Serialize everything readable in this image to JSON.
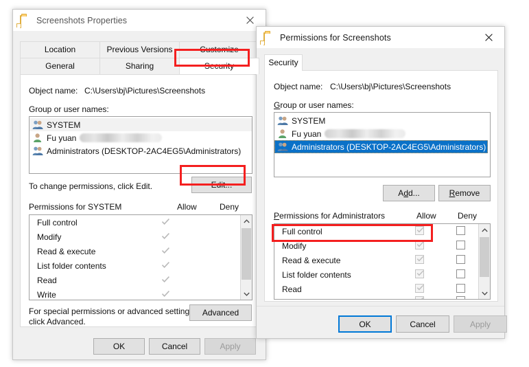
{
  "properties_dialog": {
    "title": "Screenshots Properties",
    "icon": "folder-icon",
    "close_label": "✕",
    "tabs_row1": [
      {
        "label": "Location"
      },
      {
        "label": "Previous Versions"
      },
      {
        "label": "Customize"
      }
    ],
    "tabs_row2": [
      {
        "label": "General"
      },
      {
        "label": "Sharing"
      },
      {
        "label": "Security"
      }
    ],
    "active_tab": "Security",
    "object_name_label": "Object name:",
    "object_name_value": "C:\\Users\\bj\\Pictures\\Screenshots",
    "group_label": "Group or user names:",
    "users": [
      {
        "name": "SYSTEM",
        "icon": "group-icon",
        "redacted": false,
        "highlight": true
      },
      {
        "name": "Fu yuan",
        "icon": "user-icon",
        "redacted": true,
        "highlight": false
      },
      {
        "name": "Administrators (DESKTOP-2AC4EG5\\Administrators)",
        "icon": "group-icon",
        "redacted": false,
        "highlight": false
      }
    ],
    "edit_hint": "To change permissions, click Edit.",
    "edit_button": "Edit...",
    "permissions_header": "Permissions for SYSTEM",
    "allow_column": "Allow",
    "deny_column": "Deny",
    "permissions": [
      {
        "name": "Full control",
        "allow": "check-dim",
        "deny": "none"
      },
      {
        "name": "Modify",
        "allow": "check-dim",
        "deny": "none"
      },
      {
        "name": "Read & execute",
        "allow": "check-dim",
        "deny": "none"
      },
      {
        "name": "List folder contents",
        "allow": "check-dim",
        "deny": "none"
      },
      {
        "name": "Read",
        "allow": "check-dim",
        "deny": "none"
      },
      {
        "name": "Write",
        "allow": "check-dim",
        "deny": "none"
      }
    ],
    "advanced_hint_line1": "For special permissions or advanced settings,",
    "advanced_hint_line2": "click Advanced.",
    "advanced_button": "Advanced",
    "ok_button": "OK",
    "cancel_button": "Cancel",
    "apply_button": "Apply"
  },
  "permissions_dialog": {
    "title": "Permissions for Screenshots",
    "icon": "folder-icon",
    "close_label": "✕",
    "tab_label": "Security",
    "object_name_label": "Object name:",
    "object_name_value": "C:\\Users\\bj\\Pictures\\Screenshots",
    "group_label": "Group or user names:",
    "users": [
      {
        "name": "SYSTEM",
        "icon": "group-icon",
        "redacted": false,
        "selected": false
      },
      {
        "name": "Fu yuan",
        "icon": "user-icon",
        "redacted": true,
        "selected": false
      },
      {
        "name": "Administrators (DESKTOP-2AC4EG5\\Administrators)",
        "icon": "group-icon",
        "redacted": false,
        "selected": true
      }
    ],
    "add_button": "Add...",
    "add_button_accel": "d",
    "remove_button": "Remove",
    "permissions_header": "Permissions for Administrators",
    "allow_column": "Allow",
    "deny_column": "Deny",
    "permissions": [
      {
        "name": "Full control",
        "allow": "checkbox-checked-dim",
        "deny": "checkbox-empty"
      },
      {
        "name": "Modify",
        "allow": "checkbox-checked-dim",
        "deny": "checkbox-empty"
      },
      {
        "name": "Read & execute",
        "allow": "checkbox-checked-dim",
        "deny": "checkbox-empty"
      },
      {
        "name": "List folder contents",
        "allow": "checkbox-checked-dim",
        "deny": "checkbox-empty"
      },
      {
        "name": "Read",
        "allow": "checkbox-checked-dim",
        "deny": "checkbox-empty"
      }
    ],
    "ok_button": "OK",
    "cancel_button": "Cancel",
    "apply_button": "Apply"
  },
  "annotations": {
    "highlight_color": "#f41f1f",
    "boxes": [
      {
        "target": "security-tab"
      },
      {
        "target": "edit-button"
      },
      {
        "target": "full-control-row"
      }
    ]
  }
}
